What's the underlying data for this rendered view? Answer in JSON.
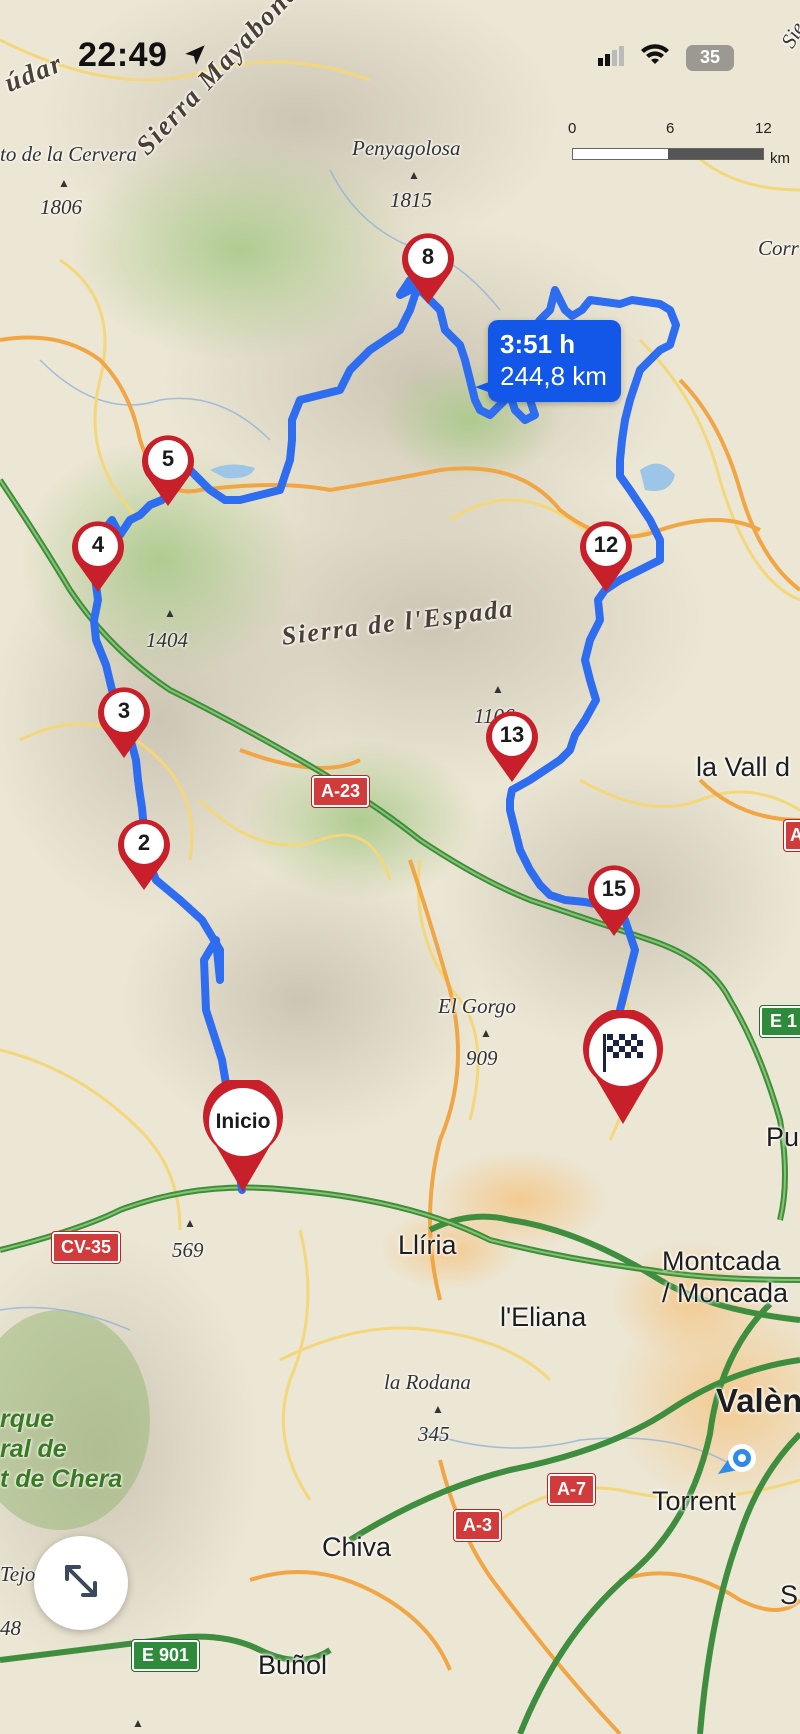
{
  "status_bar": {
    "time": "22:49",
    "battery": "35",
    "icons": [
      "location-arrow-icon",
      "signal-icon",
      "wifi-icon",
      "battery-icon"
    ]
  },
  "scale": {
    "ticks": [
      "0",
      "6",
      "12"
    ],
    "unit": "km"
  },
  "route": {
    "duration": "3:51 h",
    "distance": "244,8 km",
    "color": "#2f6df0",
    "badge_color": "#1357e8"
  },
  "waypoints": {
    "start": "Inicio",
    "w2": "2",
    "w3": "3",
    "w4": "4",
    "w5": "5",
    "w8": "8",
    "w12": "12",
    "w13": "13",
    "w15": "15"
  },
  "finish_icon": "checkered-flag-icon",
  "mountain_ranges": {
    "mayabona": "Sierra Mayabona",
    "espada": "Sierra de l'Espada",
    "top_left": "údar"
  },
  "peaks": {
    "cervera": {
      "name": "to de la Cervera",
      "alt": "1806"
    },
    "penyagolosa": {
      "name": "Penyagolosa",
      "alt": "1815"
    },
    "p1404": {
      "alt": "1404"
    },
    "p1106": {
      "alt": "1106"
    },
    "gorgo": {
      "name": "El Gorgo",
      "alt": "909"
    },
    "p569": {
      "alt": "569"
    },
    "rodana": {
      "name": "la Rodana",
      "alt": "345"
    },
    "p48": {
      "alt": "48"
    }
  },
  "towns": {
    "corr": "Corr",
    "vall": "la Vall d",
    "pu": "Pu",
    "liria": "Llíria",
    "montcada": "Montcada",
    "moncada": "/ Moncada",
    "eliana": "l'Eliana",
    "valencia": "Valèn",
    "torrent": "Torrent",
    "chiva": "Chiva",
    "bunol": "Buñol",
    "tejo": "Tejo",
    "sie": "Sie",
    "s": "S"
  },
  "parks": {
    "line1": "rque",
    "line2": "ral de",
    "line3": "t de Chera"
  },
  "roads": {
    "a23": "A-23",
    "cv35": "CV-35",
    "a7": "A-7",
    "a3": "A-3",
    "e1": "E 1",
    "e901": "E 901",
    "a_right": "A"
  },
  "controls": {
    "expand_icon": "expand-arrows-icon"
  }
}
